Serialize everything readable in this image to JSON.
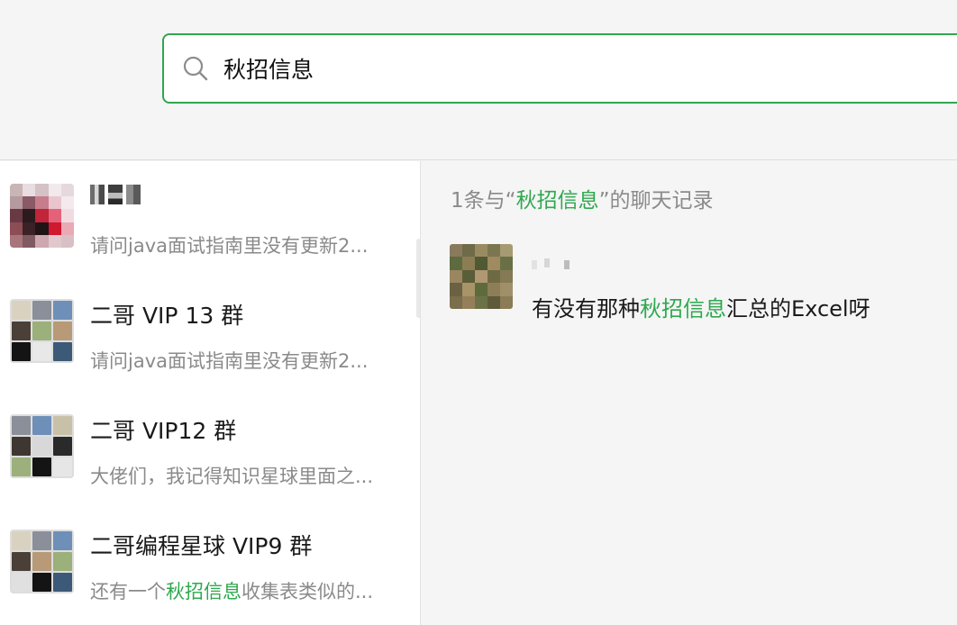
{
  "search": {
    "query": "秋招信息",
    "icon": "search-icon"
  },
  "conversations": [
    {
      "name": "",
      "name_redacted": true,
      "snippet": "请问java面试指南里没有更新2...",
      "snippet_pre": "请问java面试指南里没有更新2...",
      "snippet_hl": "",
      "snippet_post": ""
    },
    {
      "name": "二哥 VIP 13 群",
      "snippet_pre": "请问java面试指南里没有更新2...",
      "snippet_hl": "",
      "snippet_post": ""
    },
    {
      "name": "二哥 VIP12 群",
      "snippet_pre": "大佬们，我记得知识星球里面之...",
      "snippet_hl": "",
      "snippet_post": ""
    },
    {
      "name": "二哥编程星球 VIP9 群",
      "snippet_pre": "还有一个",
      "snippet_hl": "秋招信息",
      "snippet_post": "收集表类似的..."
    }
  ],
  "results": {
    "header_pre": "1条与“",
    "header_hl": "秋招信息",
    "header_post": "”的聊天记录",
    "message_pre": "有没有那种",
    "message_hl": "秋招信息",
    "message_post": "汇总的Excel呀"
  },
  "colors": {
    "accent": "#2fa84f",
    "muted_text": "#8a8a8a",
    "background": "#f5f5f5"
  }
}
